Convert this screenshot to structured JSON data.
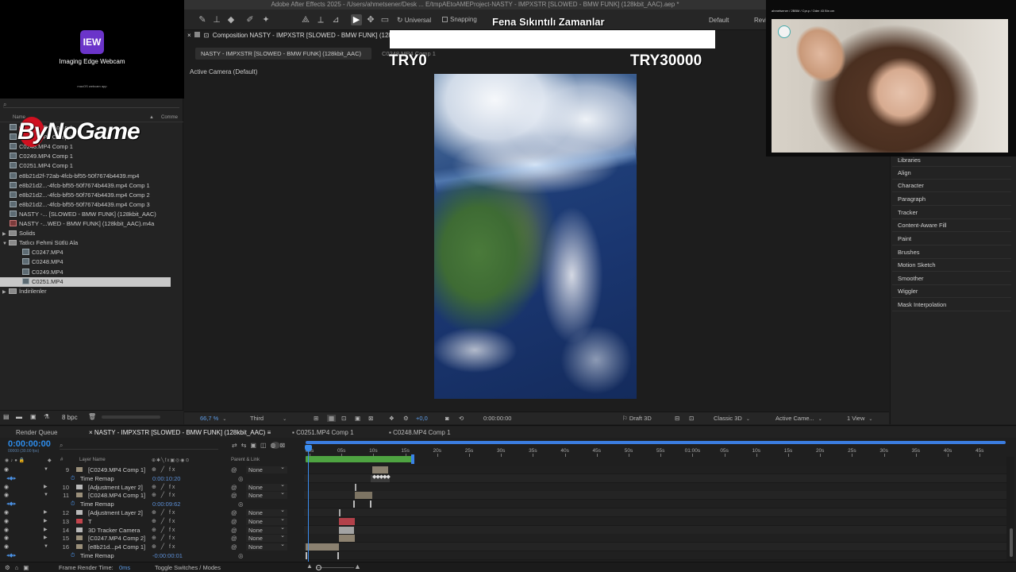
{
  "app": {
    "window_title": "Adobe After Effects 2025 - /Users/ahmetsener/Desk ... E/tmpAEtoAMEProject-NASTY - IMPXSTR [SLOWED - BMW FUNK] (128kbit_AAC).aep *"
  },
  "toolbar": {
    "universal_label": "Universal",
    "snapping_label": "Snapping",
    "workspace_label": "Default",
    "review_label": "Revi"
  },
  "webcam_card": {
    "logo_text": "IEW",
    "title": "Imaging Edge Webcam",
    "subtitle": "macOS webcam app"
  },
  "project": {
    "search_placeholder": "",
    "col_name": "Name",
    "col_comment": "Comme",
    "items": [
      {
        "label": "C0247.MP4 Comp 1",
        "kind": "comp",
        "indent": 0
      },
      {
        "label": "C0248.MP4 Comp 1",
        "kind": "comp",
        "indent": 0
      },
      {
        "label": "C0248.MP4 Comp 1",
        "kind": "comp",
        "indent": 0
      },
      {
        "label": "C0249.MP4 Comp 1",
        "kind": "comp",
        "indent": 0
      },
      {
        "label": "C0251.MP4 Comp 1",
        "kind": "comp",
        "indent": 0
      },
      {
        "label": "e8b21d2f-72ab-4fcb-bf55-50f7674b4439.mp4",
        "kind": "file",
        "indent": 0
      },
      {
        "label": "e8b21d2...-4fcb-bf55-50f7674b4439.mp4 Comp 1",
        "kind": "comp",
        "indent": 0
      },
      {
        "label": "e8b21d2...-4fcb-bf55-50f7674b4439.mp4 Comp 2",
        "kind": "comp",
        "indent": 0
      },
      {
        "label": "e8b21d2...-4fcb-bf55-50f7674b4439.mp4 Comp 3",
        "kind": "comp",
        "indent": 0
      },
      {
        "label": "NASTY -... [SLOWED - BMW FUNK] (128kbit_AAC)",
        "kind": "comp",
        "indent": 0
      },
      {
        "label": "NASTY -...WED - BMW FUNK] (128kbit_AAC).m4a",
        "kind": "audio",
        "indent": 0
      },
      {
        "label": "Solids",
        "kind": "folder",
        "indent": 0
      },
      {
        "label": "Tatlıcı Fehmi Sütlü Ala",
        "kind": "folder-open",
        "indent": 0
      },
      {
        "label": "C0247.MP4",
        "kind": "file",
        "indent": 1
      },
      {
        "label": "C0248.MP4",
        "kind": "file",
        "indent": 1
      },
      {
        "label": "C0249.MP4",
        "kind": "file",
        "indent": 1
      },
      {
        "label": "C0251.MP4",
        "kind": "file",
        "indent": 1,
        "selected": true
      },
      {
        "label": "İndirilenler",
        "kind": "folder",
        "indent": 0
      }
    ],
    "bpc_label": "8 bpc",
    "watermark_text": "ByNoGame"
  },
  "viewer": {
    "comp_tab": "Composition NASTY - IMPXSTR [SLOWED - BMW FUNK] (128",
    "flow_active": "NASTY - IMPXSTR [SLOWED - BMW FUNK] (128kbit_AAC)",
    "flow_next": "C0248.MP4 Comp 1",
    "active_camera_label": "Active Camera (Default)",
    "zoom": "66,7 %",
    "resolution": "Third",
    "exposure": "+0,0",
    "timecode": "0:00:00:00",
    "draft_label": "Draft 3D",
    "renderer": "Classic 3D",
    "camera_view": "Active Came...",
    "views": "1 View"
  },
  "stream_overlay": {
    "title": "Fena Sıkıntılı Zamanlar",
    "left_value": "TRY0",
    "right_value": "TRY30000",
    "cam_hud": "ahmetsener / 2BBM / Cpr.p / Oder 43 Bin cm"
  },
  "right_panel": {
    "items": [
      "Libraries",
      "Align",
      "Character",
      "Paragraph",
      "Tracker",
      "Content-Aware Fill",
      "Paint",
      "Brushes",
      "Motion Sketch",
      "Smoother",
      "Wiggler",
      "Mask Interpolation"
    ]
  },
  "timeline": {
    "tabs": [
      {
        "label": "Render Queue",
        "active": false
      },
      {
        "label": "NASTY - IMPXSTR [SLOWED - BMW FUNK] (128kbit_AAC)",
        "active": true
      },
      {
        "label": "C0251.MP4 Comp 1",
        "active": false
      },
      {
        "label": "C0248.MP4 Comp 1",
        "active": false
      }
    ],
    "timecode": "0:00:00:00",
    "fps": "00000 (30.00 fps)",
    "header_layer_name": "Layer Name",
    "header_parent": "Parent & Link",
    "ruler_ticks": [
      "00s",
      "05s",
      "10s",
      "15s",
      "20s",
      "25s",
      "30s",
      "35s",
      "40s",
      "45s",
      "50s",
      "55s",
      "01:00s",
      "05s",
      "10s",
      "15s",
      "20s",
      "25s",
      "30s",
      "35s",
      "40s",
      "45s"
    ],
    "rows": [
      {
        "type": "layer",
        "num": "9",
        "name": "[C0249.MP4 Comp 1]",
        "color": "#9a8f7a",
        "parent": "None"
      },
      {
        "type": "sub",
        "name": "Time Remap",
        "value": "0:00:10:20"
      },
      {
        "type": "layer",
        "num": "10",
        "name": "[Adjustment Layer 2]",
        "color": "#b8b8b8",
        "parent": "None"
      },
      {
        "type": "layer",
        "num": "11",
        "name": "[C0248.MP4 Comp 1]",
        "color": "#9a8f7a",
        "parent": "None"
      },
      {
        "type": "sub",
        "name": "Time Remap",
        "value": "0:00:09:62"
      },
      {
        "type": "layer",
        "num": "12",
        "name": "[Adjustment Layer 2]",
        "color": "#b8b8b8",
        "parent": "None"
      },
      {
        "type": "layer",
        "num": "13",
        "name": "T",
        "color": "#c2444c",
        "parent": "None"
      },
      {
        "type": "layer",
        "num": "14",
        "name": "3D Tracker Camera",
        "color": "#b8b8b8",
        "parent": "None"
      },
      {
        "type": "layer",
        "num": "15",
        "name": "[C0247.MP4 Comp 2]",
        "color": "#9a8f7a",
        "parent": "None"
      },
      {
        "type": "layer",
        "num": "16",
        "name": "[e8b21d...p4 Comp 1]",
        "color": "#9a8f7a",
        "parent": "None"
      },
      {
        "type": "sub",
        "name": "Time Remap",
        "value": "-0:00:00:01"
      }
    ],
    "footer_render_label": "Frame Render Time:",
    "footer_render_value": "0ms",
    "footer_toggle_label": "Toggle Switches / Modes"
  },
  "colors": {
    "accent": "#2d8ceb",
    "range_bar": "#4ea341",
    "selection": "#c8c8c8"
  }
}
